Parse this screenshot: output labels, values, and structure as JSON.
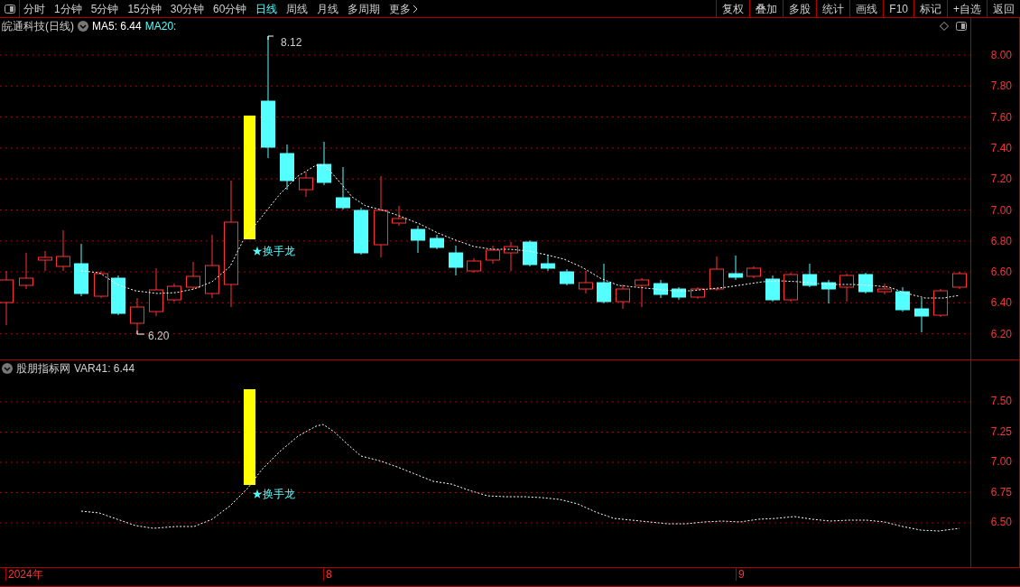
{
  "toolbar": {
    "periods": [
      {
        "label": "分时",
        "selected": false
      },
      {
        "label": "1分钟",
        "selected": false
      },
      {
        "label": "5分钟",
        "selected": false
      },
      {
        "label": "15分钟",
        "selected": false
      },
      {
        "label": "30分钟",
        "selected": false
      },
      {
        "label": "60分钟",
        "selected": false
      },
      {
        "label": "日线",
        "selected": true
      },
      {
        "label": "周线",
        "selected": false
      },
      {
        "label": "月线",
        "selected": false
      },
      {
        "label": "多周期",
        "selected": false
      },
      {
        "label": "更多",
        "selected": false
      }
    ],
    "actions": [
      "复权",
      "叠加",
      "多股",
      "统计",
      "画线",
      "F10",
      "标记",
      "+自选",
      "返回"
    ]
  },
  "main_panel": {
    "stock_name": "皖通科技(日线)",
    "ma5": "MA5: 6.44",
    "ma20": "MA20:",
    "high_label": "8.12",
    "low_label": "6.20",
    "signal_label": "★换手龙",
    "y_axis_labels": [
      "8.00",
      "7.80",
      "7.60",
      "7.40",
      "7.20",
      "7.00",
      "6.80",
      "6.60",
      "6.40",
      "6.20"
    ]
  },
  "indicator_panel": {
    "name": "股朋指标网",
    "value": "VAR41: 6.44",
    "signal_label": "★换手龙",
    "y_axis_labels": [
      "7.50",
      "7.25",
      "7.00",
      "6.75",
      "6.50"
    ]
  },
  "time_axis": {
    "labels": [
      "2024年",
      "8",
      "9"
    ]
  }
}
